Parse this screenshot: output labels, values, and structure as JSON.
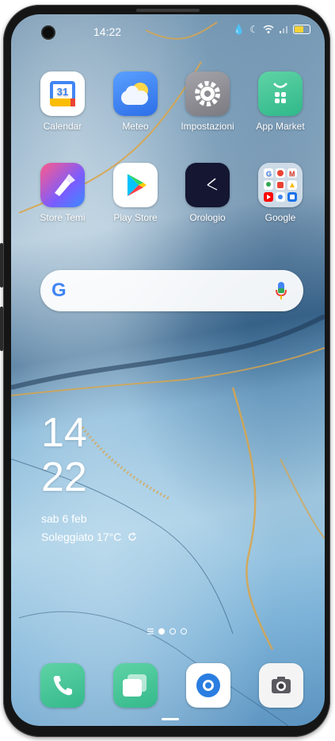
{
  "status_bar": {
    "time": "14:22"
  },
  "apps_row1": [
    {
      "label": "Calendar",
      "icon": "calendar-icon",
      "icon_text": "31"
    },
    {
      "label": "Meteo",
      "icon": "weather-icon"
    },
    {
      "label": "Impostazioni",
      "icon": "settings-icon"
    },
    {
      "label": "App Market",
      "icon": "app-market-icon"
    }
  ],
  "apps_row2": [
    {
      "label": "Store Temi",
      "icon": "theme-store-icon"
    },
    {
      "label": "Play Store",
      "icon": "play-store-icon"
    },
    {
      "label": "Orologio",
      "icon": "clock-icon"
    },
    {
      "label": "Google",
      "icon": "google-folder-icon"
    }
  ],
  "search": {
    "logo": "G"
  },
  "clock_widget": {
    "hour": "14",
    "minute": "22",
    "date": "sab 6 feb",
    "weather": "Soleggiato 17°C"
  },
  "dock": [
    {
      "name": "phone",
      "icon": "phone-icon"
    },
    {
      "name": "messages",
      "icon": "messages-icon"
    },
    {
      "name": "browser",
      "icon": "browser-icon"
    },
    {
      "name": "camera",
      "icon": "camera-icon"
    }
  ],
  "colors": {
    "accent_gold": "#d9a54a",
    "battery": "#f4d33a"
  }
}
